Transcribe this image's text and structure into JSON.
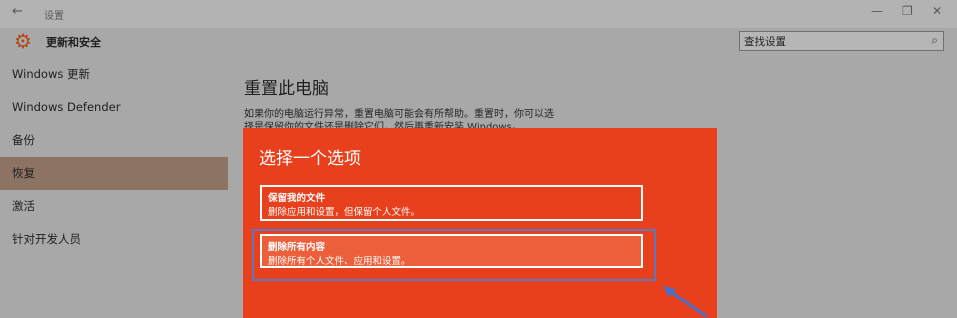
{
  "window": {
    "back_glyph": "←",
    "title": "设置",
    "controls": {
      "minimize": "—",
      "maximize": "❐",
      "close": "✕"
    }
  },
  "header": {
    "icon": "gear-icon",
    "title": "更新和安全",
    "search_value": "查找设置",
    "search_icon": "search-icon"
  },
  "sidebar": {
    "items": [
      {
        "label": "Windows 更新"
      },
      {
        "label": "Windows Defender"
      },
      {
        "label": "备份"
      },
      {
        "label": "恢复",
        "active": true
      },
      {
        "label": "激活"
      },
      {
        "label": "针对开发人员"
      }
    ]
  },
  "main": {
    "title": "重置此电脑",
    "description": "如果你的电脑运行异常，重置电脑可能会有所帮助。重置时，你可以选择是保留你的文件还是删除它们，然后再重新安装 Windows。"
  },
  "dialog": {
    "title": "选择一个选项",
    "options": [
      {
        "heading": "保留我的文件",
        "subtitle": "删除应用和设置，但保留个人文件。"
      },
      {
        "heading": "删除所有内容",
        "subtitle": "删除所有个人文件、应用和设置。"
      }
    ]
  },
  "colors": {
    "dialog_bg": "#e8401c",
    "sidebar_active": "#8d7364",
    "focus_ring": "#5b78bf",
    "annotation_arrow": "#4a6fc9"
  }
}
